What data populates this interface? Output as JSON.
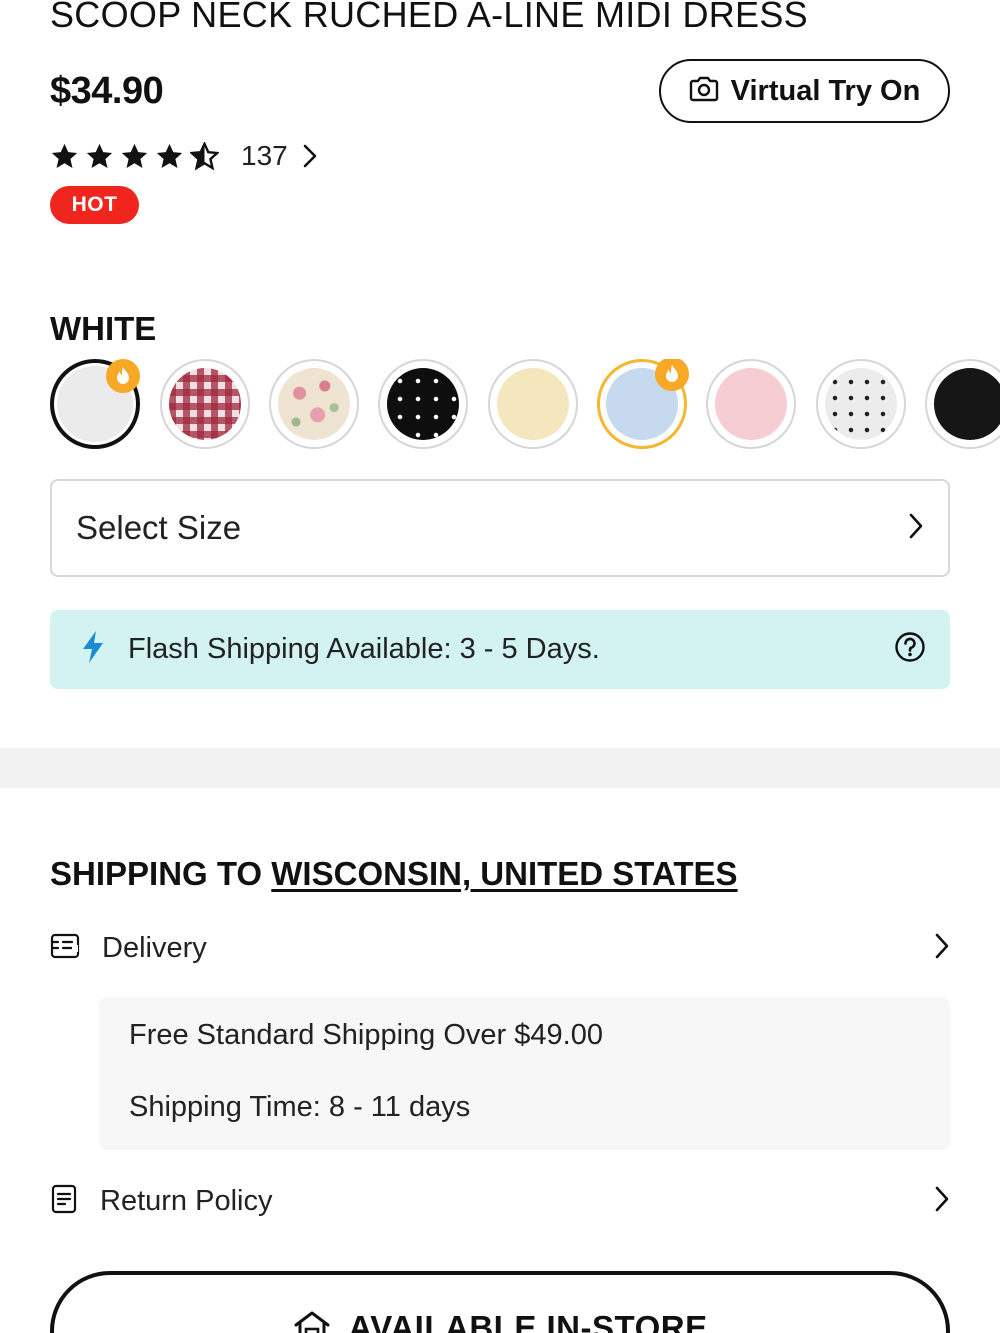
{
  "product": {
    "title": "SCOOP NECK RUCHED A-LINE MIDI DRESS",
    "price": "$34.90",
    "virtual_try_on_label": "Virtual Try On",
    "rating": 4.5,
    "review_count": "137",
    "badge": "HOT"
  },
  "color": {
    "selected_label": "WHITE",
    "swatches": [
      {
        "name": "white",
        "color": "#ebebeb",
        "hot": true,
        "selected": true
      },
      {
        "name": "red-gingham",
        "color": "#b0404e",
        "hot": false
      },
      {
        "name": "floral-cream",
        "color": "#efe2cf",
        "hot": false
      },
      {
        "name": "black-polka-dot",
        "color": "#111111",
        "hot": false
      },
      {
        "name": "butter-yellow",
        "color": "#f4e6bd",
        "hot": false
      },
      {
        "name": "light-blue",
        "color": "#c6d9ef",
        "hot": true
      },
      {
        "name": "pink",
        "color": "#f5cdd2",
        "hot": false
      },
      {
        "name": "white-black-dot",
        "color": "#ececec",
        "hot": false
      },
      {
        "name": "black",
        "color": "#161616",
        "hot": false
      }
    ]
  },
  "size": {
    "placeholder": "Select Size"
  },
  "flash_shipping": {
    "text": "Flash Shipping Available: 3 - 5 Days."
  },
  "shipping": {
    "heading_prefix": "SHIPPING TO",
    "location": "WISCONSIN, UNITED STATES",
    "delivery_label": "Delivery",
    "free_shipping": "Free Standard Shipping Over $49.00",
    "shipping_time": "Shipping Time: 8 - 11 days",
    "return_policy_label": "Return Policy"
  },
  "store": {
    "label": "AVAILABLE IN-STORE"
  },
  "colors": {
    "hot_badge": "#f0261e",
    "flash_bg": "#d3f3f3",
    "flash_icon": "#1b8ccf",
    "fire_badge": "#f7a824"
  }
}
